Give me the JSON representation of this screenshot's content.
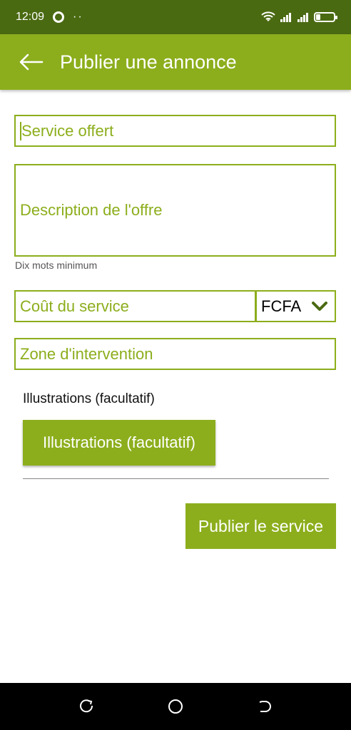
{
  "status_bar": {
    "time": "12:09",
    "dots": "··",
    "icons": [
      "chrome-icon",
      "wifi-icon",
      "signal-icon",
      "signal-icon",
      "battery-icon"
    ]
  },
  "app_bar": {
    "title": "Publier une annonce",
    "back_icon": "arrow-left-icon"
  },
  "form": {
    "service_placeholder": "Service offert",
    "description_placeholder": "Description de l'offre",
    "description_hint": "Dix mots minimum",
    "cost_placeholder": "Coût du service",
    "currency_selected": "FCFA",
    "zone_placeholder": "Zone d'intervention",
    "illustrations_label": "Illustrations (facultatif)",
    "illustrations_button": "Illustrations (facultatif)",
    "publish_button": "Publier le service"
  },
  "nav_bar": {
    "icons": [
      "recent-apps-icon",
      "home-icon",
      "back-icon"
    ]
  },
  "colors": {
    "accent": "#8cae1c",
    "status_bar": "#4a6a12",
    "nav_bar": "#000000"
  }
}
